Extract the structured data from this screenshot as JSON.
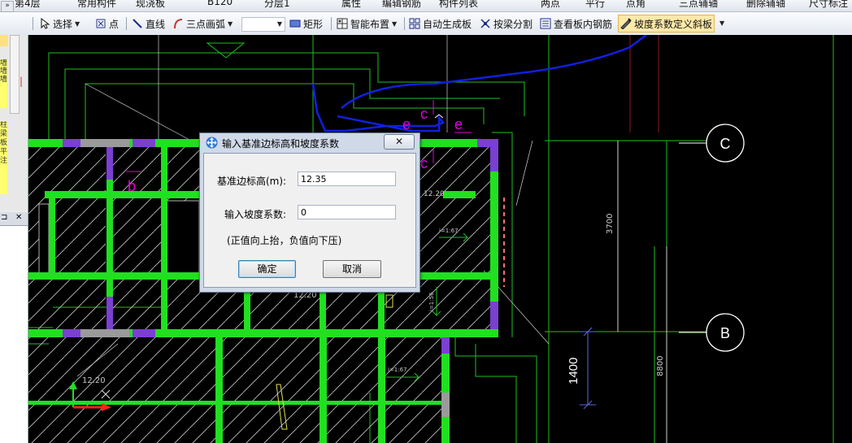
{
  "top_toolbar": {
    "items": [
      "第4层",
      "常用构件",
      "现浇板",
      "B120",
      "分层1",
      "属性",
      "编辑钢筋",
      "构件列表",
      "两点",
      "平行",
      "点角",
      "三点辅轴",
      "删除辅轴",
      "尺寸标注"
    ]
  },
  "toolbar": {
    "select": "选择",
    "point": "点",
    "line": "直线",
    "arc": "三点画弧",
    "rect": "矩形",
    "smart": "智能布置",
    "auto": "自动生成板",
    "split": "按梁分割",
    "view_rebar": "查看板内钢筋",
    "slope": "坡度系数定义斜板"
  },
  "left_panel": {
    "pin": "⊐",
    "close": "✕",
    "labels": [
      "墙",
      "墙",
      "墙",
      "柱",
      "梁",
      "板",
      "平",
      "注"
    ]
  },
  "canvas": {
    "axis_c": "C",
    "axis_b": "B",
    "dim_3700": "3700",
    "dim_8800": "8800",
    "dim_1400": "1400",
    "elev_1": "12.20",
    "elev_2": "12.20",
    "elev_3": "12.20",
    "slope_1": "i=1:67",
    "slope_2": "i=1:67",
    "slope_3": "i=1:56",
    "tag_b": "b",
    "tag_c1": "c",
    "tag_c2": "c",
    "tag_e1": "e",
    "tag_e2": "e"
  },
  "dialog": {
    "title": "输入基准边标高和坡度系数",
    "close": "✕",
    "elev_label": "基准边标高(m):",
    "elev_value": "12.35",
    "slope_label": "输入坡度系数:",
    "slope_value": "0",
    "hint": "(正值向上抬，负值向下压)",
    "ok": "确定",
    "cancel": "取消"
  },
  "colors": {
    "wall_green": "#20e020",
    "line_green": "#1fbf1f",
    "magenta": "#e000e0",
    "purple": "#7b3fd1",
    "blue_line": "#1020e0",
    "active_bg": "#fde9a8"
  }
}
